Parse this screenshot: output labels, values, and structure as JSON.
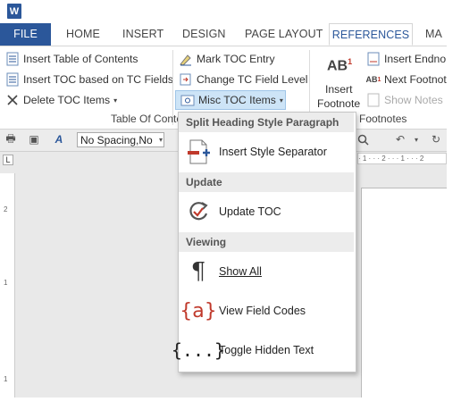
{
  "app": {
    "icon_letter": "W"
  },
  "tabs": [
    {
      "label": "FILE"
    },
    {
      "label": "HOME"
    },
    {
      "label": "INSERT"
    },
    {
      "label": "DESIGN"
    },
    {
      "label": "PAGE LAYOUT"
    },
    {
      "label": "REFERENCES"
    },
    {
      "label": "MA"
    }
  ],
  "ribbon": {
    "toc": {
      "insert_table": "Insert Table of Contents",
      "insert_toc_fields": "Insert TOC based on TC Fields",
      "delete_toc_items": "Delete TOC Items",
      "mark_toc_entry": "Mark TOC Entry",
      "change_tc_field_level": "Change TC Field Level",
      "misc_toc_items": "Misc TOC Items",
      "group_label": "Table Of Conte"
    },
    "footnotes": {
      "ab_text": "AB",
      "ab_sup": "1",
      "insert_footnote_line1": "Insert",
      "insert_footnote_line2": "Footnote",
      "insert_endnote": "Insert Endno",
      "next_footnote": "Next Footnot",
      "show_notes": "Show Notes",
      "group_label": "Footnotes"
    }
  },
  "toolbar": {
    "style_value": "No Spacing,No"
  },
  "ruler": {
    "h_text": "· 1 · · · 2 · · · 1 · · · 2",
    "v_marks": [
      "2",
      "1",
      "1"
    ]
  },
  "menu": {
    "sections": [
      {
        "header": "Split Heading Style Paragraph",
        "items": [
          {
            "label": "Insert Style Separator",
            "icon": "style-separator-icon"
          }
        ]
      },
      {
        "header": "Update",
        "items": [
          {
            "label": "Update TOC",
            "icon": "update-icon"
          }
        ]
      },
      {
        "header": "Viewing",
        "items": [
          {
            "label": "Show All",
            "icon": "pilcrow-icon"
          },
          {
            "label": "View Field Codes",
            "icon": "field-codes-icon"
          },
          {
            "label": "Toggle Hidden Text",
            "icon": "hidden-text-icon"
          }
        ]
      }
    ]
  },
  "colors": {
    "accent": "#2b579a",
    "hover": "#cde4f7",
    "red_icon": "#c0392b"
  }
}
